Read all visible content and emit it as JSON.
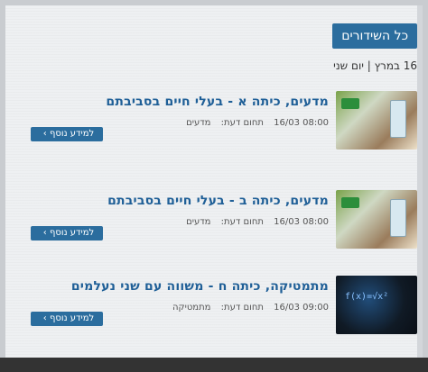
{
  "header": {
    "title": "כל השידורים"
  },
  "date_line": "16 במרץ | יום שני",
  "items": [
    {
      "title": "מדעים, כיתה א - בעלי חיים בסביבתם",
      "time": "08:00 16/03",
      "subject_label": "תחום דעת:",
      "subject": "מדעים",
      "button": "למידע נוסף"
    },
    {
      "title": "מדעים, כיתה ב - בעלי חיים בסביבתם",
      "time": "08:00 16/03",
      "subject_label": "תחום דעת:",
      "subject": "מדעים",
      "button": "למידע נוסף"
    },
    {
      "title": "מתמטיקה, כיתה ח - משווה עם שני נעלמים",
      "time": "09:00 16/03",
      "subject_label": "תחום דעת:",
      "subject": "מתמטיקה",
      "button": "למידע נוסף"
    }
  ]
}
